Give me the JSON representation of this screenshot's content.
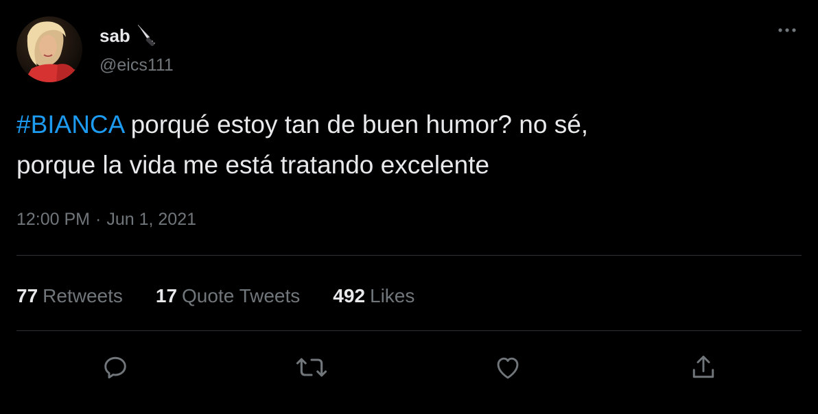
{
  "user": {
    "display_name": "sab",
    "emoji": "🔪",
    "handle": "@eics111"
  },
  "tweet": {
    "hashtag": "#BIANCA",
    "text_line1": " porqué estoy tan de buen humor? no sé,",
    "text_line2": "porque la vida me está tratando excelente",
    "time": "12:00 PM",
    "separator": "·",
    "date": "Jun 1, 2021"
  },
  "stats": {
    "retweets_count": "77",
    "retweets_label": "Retweets",
    "quotes_count": "17",
    "quotes_label": "Quote Tweets",
    "likes_count": "492",
    "likes_label": "Likes"
  },
  "actions": {
    "reply_icon": "reply-icon",
    "retweet_icon": "retweet-icon",
    "like_icon": "heart-icon",
    "share_icon": "share-icon"
  },
  "colors": {
    "background": "#000000",
    "text": "#e7e9ea",
    "muted": "#71767b",
    "accent": "#1d9bf0",
    "divider": "#2f3336"
  }
}
